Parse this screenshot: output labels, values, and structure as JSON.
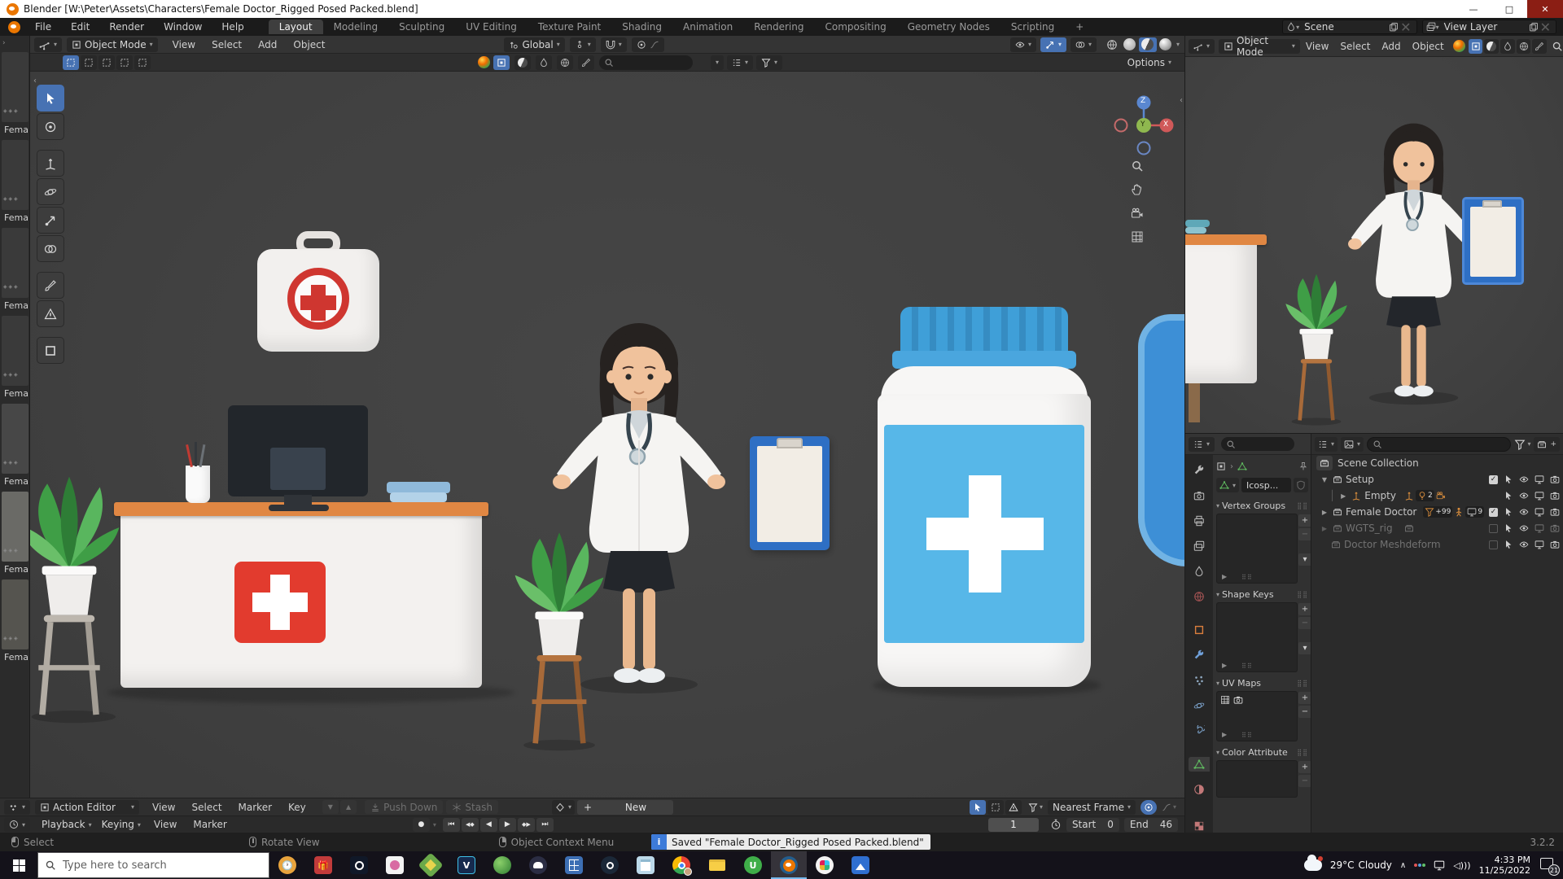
{
  "window": {
    "title": "Blender [W:\\Peter\\Assets\\Characters\\Female Doctor_Rigged Posed Packed.blend]",
    "minimize": "—",
    "maximize": "□",
    "close": "✕"
  },
  "topbar": {
    "menus": [
      "File",
      "Edit",
      "Render",
      "Window",
      "Help"
    ],
    "tabs": [
      "Layout",
      "Modeling",
      "Sculpting",
      "UV Editing",
      "Texture Paint",
      "Shading",
      "Animation",
      "Rendering",
      "Compositing",
      "Geometry Nodes",
      "Scripting"
    ],
    "active_tab": "Layout",
    "new_tab": "+",
    "scene": {
      "label": "Scene",
      "clear": "✕"
    },
    "view_layer": {
      "label": "View Layer",
      "clear": "✕"
    }
  },
  "viewport": {
    "mode": "Object Mode",
    "menus": [
      "View",
      "Select",
      "Add",
      "Object"
    ],
    "orientation": "Global",
    "options_label": "Options",
    "collapse_left": "‹",
    "collapse_right": "‹",
    "expand": "›"
  },
  "viewport2": {
    "mode": "Object Mode",
    "menus": [
      "View",
      "Select",
      "Add",
      "Object"
    ]
  },
  "gizmo": {
    "z": "Z",
    "y": "Y",
    "x": "X"
  },
  "asset_strip": {
    "items": [
      "Fema",
      "Fema",
      "Fema",
      "Fema",
      "Fema",
      "Fema",
      "Fema"
    ]
  },
  "outliner": {
    "root": "Scene Collection",
    "rows": [
      {
        "name": "Setup"
      },
      {
        "name": "Empty",
        "light_count": "2"
      },
      {
        "name": "Female Doctor",
        "mesh_badge": "+99",
        "other_badge": "9"
      },
      {
        "name": "WGTS_rig"
      },
      {
        "name": "Doctor Meshdeform"
      }
    ],
    "check": "✓"
  },
  "properties": {
    "datablock": "Icosp...",
    "panels": {
      "vertex_groups": "Vertex Groups",
      "shape_keys": "Shape Keys",
      "uv_maps": "UV Maps",
      "color_attribute": "Color Attribute"
    },
    "breadcrumb_sep": "›",
    "tab_icons": [
      "tool",
      "render",
      "output",
      "view-layer",
      "scene",
      "world",
      "object",
      "modifiers",
      "particles",
      "physics",
      "constraints",
      "object-data",
      "material",
      "texture"
    ]
  },
  "dopesheet": {
    "mode": "Action Editor",
    "menus": [
      "View",
      "Select",
      "Marker",
      "Key"
    ],
    "down": "▼",
    "up": "▲",
    "push_down": "Push Down",
    "stash": "Stash",
    "new_label": "New",
    "plus": "+",
    "snap": "Nearest Frame"
  },
  "timeline": {
    "playback": "Playback",
    "keying": "Keying",
    "menus": [
      "View",
      "Marker"
    ],
    "jump_start": "⏮",
    "prev_key": "◀◆",
    "play_rev": "◀",
    "play": "▶",
    "next_key": "◆▶",
    "jump_end": "⏭",
    "record": "●",
    "frame": "1",
    "start_label": "Start",
    "start": "0",
    "end_label": "End",
    "end": "46"
  },
  "statusbar": {
    "items": [
      "Select",
      "Rotate View",
      "Object Context Menu"
    ],
    "message": "Saved \"Female Doctor_Rigged Posed Packed.blend\"",
    "version": "3.2.2"
  },
  "taskbar": {
    "search_placeholder": "Type here to search",
    "icons": [
      "alarm-app",
      "gift-app",
      "camera-app",
      "paint-app",
      "layers-app",
      "video-editor-app",
      "green-globe-app",
      "discord-app",
      "calculator-app",
      "steam-app",
      "notepad-app",
      "chrome-app",
      "file-explorer-app",
      "green-app",
      "blender-app",
      "slack-app",
      "photos-app"
    ],
    "weather_temp": "29°C",
    "weather_text": "Cloudy",
    "hidden_icons": "∧",
    "time": "4:33 PM",
    "date": "11/25/2022",
    "notif_count": "21"
  },
  "colors": {
    "accent_blue": "#4772b3",
    "header_gray": "#343434",
    "viewport_gray": "#3e3e3e",
    "desk_orange": "#e08743",
    "cross_red": "#e23b2e",
    "bottle_blue": "#57b7e8",
    "clipboard_blue": "#2e6fc4"
  }
}
